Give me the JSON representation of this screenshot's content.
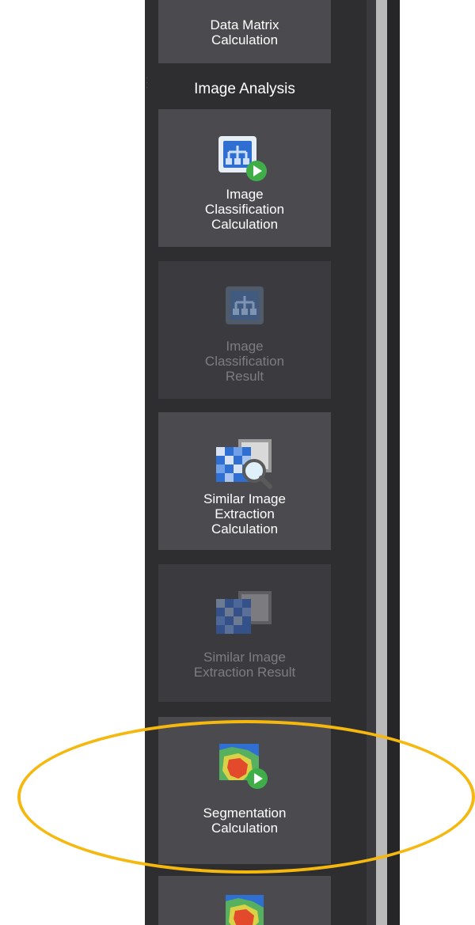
{
  "toolbar": {
    "data_matrix": {
      "label": "Data Matrix\nCalculation"
    },
    "section_header": "Image Analysis",
    "items": [
      {
        "label": "Image\nClassification\nCalculation",
        "enabled": true
      },
      {
        "label": "Image\nClassification\nResult",
        "enabled": false
      },
      {
        "label": "Similar Image\nExtraction\nCalculation",
        "enabled": true
      },
      {
        "label": "Similar Image\nExtraction Result",
        "enabled": false
      },
      {
        "label": "Segmentation\nCalculation",
        "enabled": true
      }
    ]
  },
  "colors": {
    "panel_bg": "#2e2e31",
    "tile_bg": "#4b4b4f",
    "tile_disabled_bg": "#3b3b3f",
    "highlight": "#f5b80f",
    "play_badge": "#3fae49"
  },
  "icons": {
    "classification_calc": "hierarchy-play-icon",
    "classification_result": "hierarchy-icon",
    "similar_calc": "mosaic-magnifier-icon",
    "similar_result": "mosaic-icon",
    "segmentation_calc": "segmentation-map-play-icon",
    "segmentation_result": "segmentation-map-icon"
  }
}
